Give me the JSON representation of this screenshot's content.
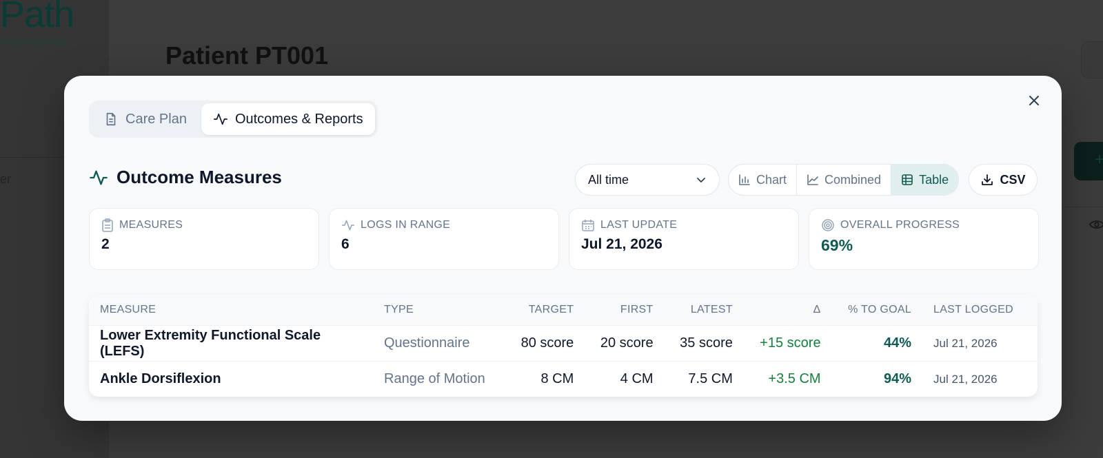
{
  "background": {
    "logo_text": "Path",
    "logo_sub": "ment Roadmap",
    "nav_item": "er",
    "page_title": "Patient PT001",
    "plus_label": "+"
  },
  "modal": {
    "tabs": [
      {
        "label": "Care Plan",
        "icon": "document-icon",
        "active": false
      },
      {
        "label": "Outcomes & Reports",
        "icon": "activity-icon",
        "active": true
      }
    ],
    "section_title": "Outcome Measures",
    "range_select": {
      "value": "All time"
    },
    "view_options": [
      {
        "label": "Chart",
        "icon": "bar-chart-icon",
        "active": false
      },
      {
        "label": "Combined",
        "icon": "line-chart-icon",
        "active": false
      },
      {
        "label": "Table",
        "icon": "table-icon",
        "active": true
      }
    ],
    "csv_label": "CSV",
    "stats": [
      {
        "label": "MEASURES",
        "value": "2",
        "icon": "clipboard-icon"
      },
      {
        "label": "LOGS IN RANGE",
        "value": "6",
        "icon": "activity-icon"
      },
      {
        "label": "LAST UPDATE",
        "value": "Jul 21, 2026",
        "icon": "calendar-icon"
      },
      {
        "label": "OVERALL PROGRESS",
        "value": "69%",
        "icon": "target-icon"
      }
    ],
    "table": {
      "headers": [
        "MEASURE",
        "TYPE",
        "TARGET",
        "FIRST",
        "LATEST",
        "Δ",
        "% TO GOAL",
        "LAST LOGGED"
      ],
      "rows": [
        {
          "measure": "Lower Extremity Functional Scale (LEFS)",
          "type": "Questionnaire",
          "target": "80 score",
          "first": "20 score",
          "latest": "35 score",
          "delta": "+15 score",
          "to_goal": "44%",
          "last_logged": "Jul 21, 2026"
        },
        {
          "measure": "Ankle Dorsiflexion",
          "type": "Range of Motion",
          "target": "8 CM",
          "first": "4 CM",
          "latest": "7.5 CM",
          "delta": "+3.5 CM",
          "to_goal": "94%",
          "last_logged": "Jul 21, 2026"
        }
      ]
    }
  },
  "colors": {
    "accent": "#0f5a52",
    "positive": "#15803d",
    "overlay": "#3a3a3a"
  }
}
